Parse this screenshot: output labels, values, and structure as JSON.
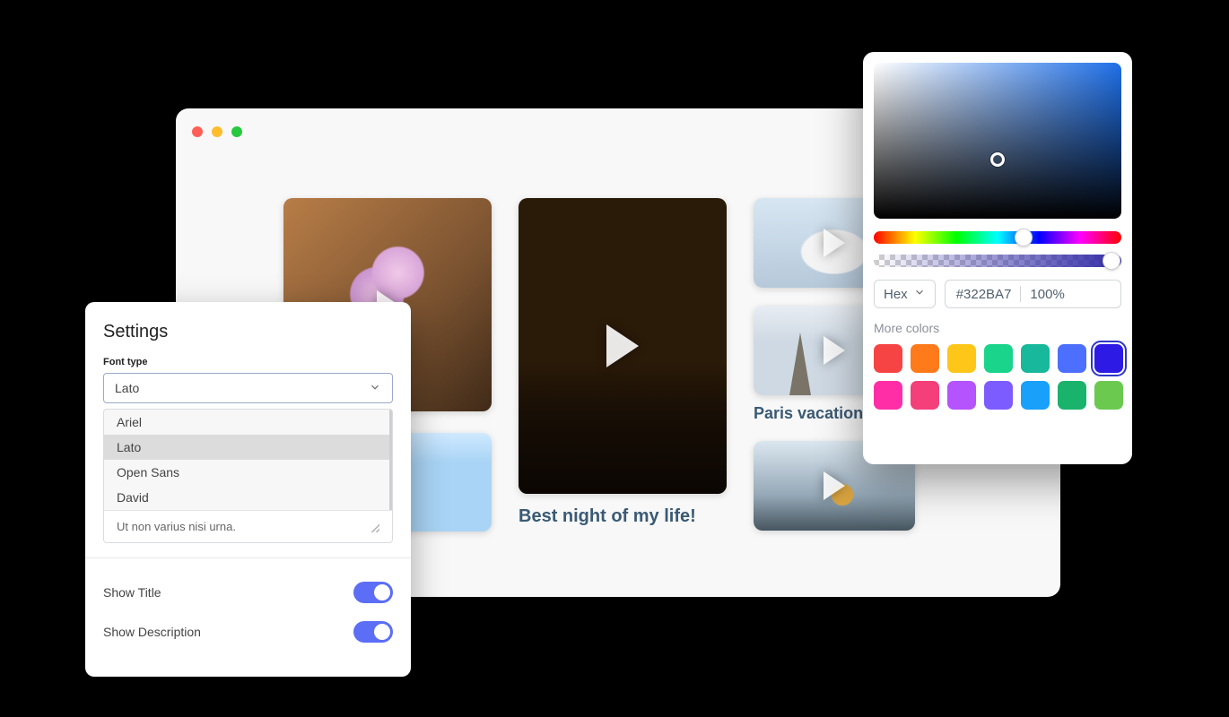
{
  "gallery": {
    "items": [
      {
        "caption": "Best night of my life!"
      },
      {
        "caption": "Paris vacation"
      }
    ]
  },
  "settings": {
    "title": "Settings",
    "font_type_label": "Font type",
    "selected_font": "Lato",
    "font_options": [
      "Ariel",
      "Lato",
      "Open Sans",
      "David"
    ],
    "description_value": "Ut non varius nisi urna.",
    "toggles": [
      {
        "label": "Show Title",
        "on": true
      },
      {
        "label": "Show Description",
        "on": true
      }
    ]
  },
  "color_picker": {
    "mode": "Hex",
    "hex": "#322BA7",
    "opacity": "100%",
    "more_label": "More colors",
    "swatches": [
      "#F64444",
      "#FF7A1A",
      "#FFC61A",
      "#19D48A",
      "#17B89C",
      "#4C6FFF",
      "#2D1AE5",
      "#FF2EA6",
      "#F43F7A",
      "#B553FF",
      "#7C5CFF",
      "#18A0FB",
      "#19B36B",
      "#6BC950"
    ],
    "selected_swatch_index": 6
  }
}
